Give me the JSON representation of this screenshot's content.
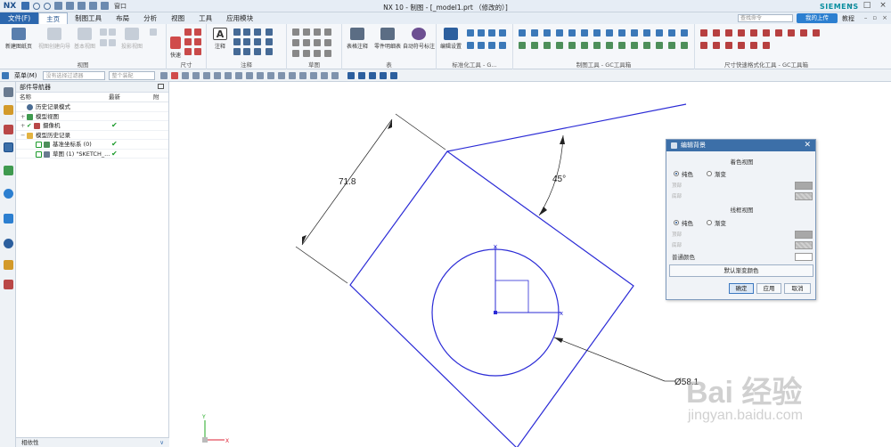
{
  "window": {
    "app_title": "NX 10 - 制图 - [_model1.prt （修改的）]",
    "brand": "SIEMENS",
    "logo": "NX",
    "window_menu": "窗口"
  },
  "menubar": {
    "tabs": [
      "文件(F)",
      "主页",
      "制图工具",
      "布局",
      "分析",
      "视图",
      "工具",
      "应用模块"
    ],
    "active_tab": "主页",
    "search_placeholder": "查找命令",
    "cloud_button": "我的上传",
    "help_link": "教程"
  },
  "ribbon": {
    "groups": [
      {
        "label": "视图",
        "buttons": [
          "新建图纸页",
          "视图创建向导",
          "基本视图",
          "投影视图"
        ]
      },
      {
        "label": "尺寸",
        "buttons": [
          "快速"
        ]
      },
      {
        "label": "注释",
        "buttons": [
          "注释"
        ]
      },
      {
        "label": "草图",
        "buttons": []
      },
      {
        "label": "表",
        "buttons": [
          "表格注释",
          "零件明细表",
          "自动符号标注"
        ]
      },
      {
        "label": "标准化工具 - G...",
        "buttons": [
          "编辑设置"
        ]
      },
      {
        "label": "制图工具 - GC工具箱",
        "buttons": []
      },
      {
        "label": "尺寸快速格式化工具 - GC工具箱",
        "buttons": []
      }
    ]
  },
  "selection_bar": {
    "menu_label": "菜单(M)",
    "filter_placeholder": "没有选择过滤器",
    "scope_placeholder": "整个装配"
  },
  "navigator": {
    "title": "部件导航器",
    "columns": [
      "名称",
      "最新",
      "附"
    ],
    "rows": [
      {
        "label": "历史记录模式",
        "indent": 0,
        "check": ""
      },
      {
        "label": "模型视图",
        "indent": 0,
        "check": ""
      },
      {
        "label": "摄像机",
        "indent": 0,
        "check": "✔"
      },
      {
        "label": "模型历史记录",
        "indent": 0,
        "check": ""
      },
      {
        "label": "基准坐标系 (0)",
        "indent": 1,
        "check": "✔"
      },
      {
        "label": "草图 (1) \"SKETCH_...",
        "indent": 1,
        "check": "✔"
      }
    ],
    "footer": "相依性"
  },
  "drawing": {
    "dim_linear": "71.8",
    "dim_angle": "45°",
    "dim_diameter": "Ø58.1",
    "axis_x": "X",
    "axis_y": "Y"
  },
  "dialog": {
    "title": "编辑背景",
    "shaded_title": "着色视图",
    "wireframe_title": "线框视图",
    "option_solid": "纯色",
    "option_gradient": "渐变",
    "top_label": "顶部",
    "bottom_label": "底部",
    "plain_color_label": "普通颜色",
    "default_gradient_button": "默认渐变颜色",
    "ok": "确定",
    "apply": "应用",
    "cancel": "取消"
  },
  "watermark": {
    "text": "Bai 经验",
    "url": "jingyan.baidu.com"
  }
}
